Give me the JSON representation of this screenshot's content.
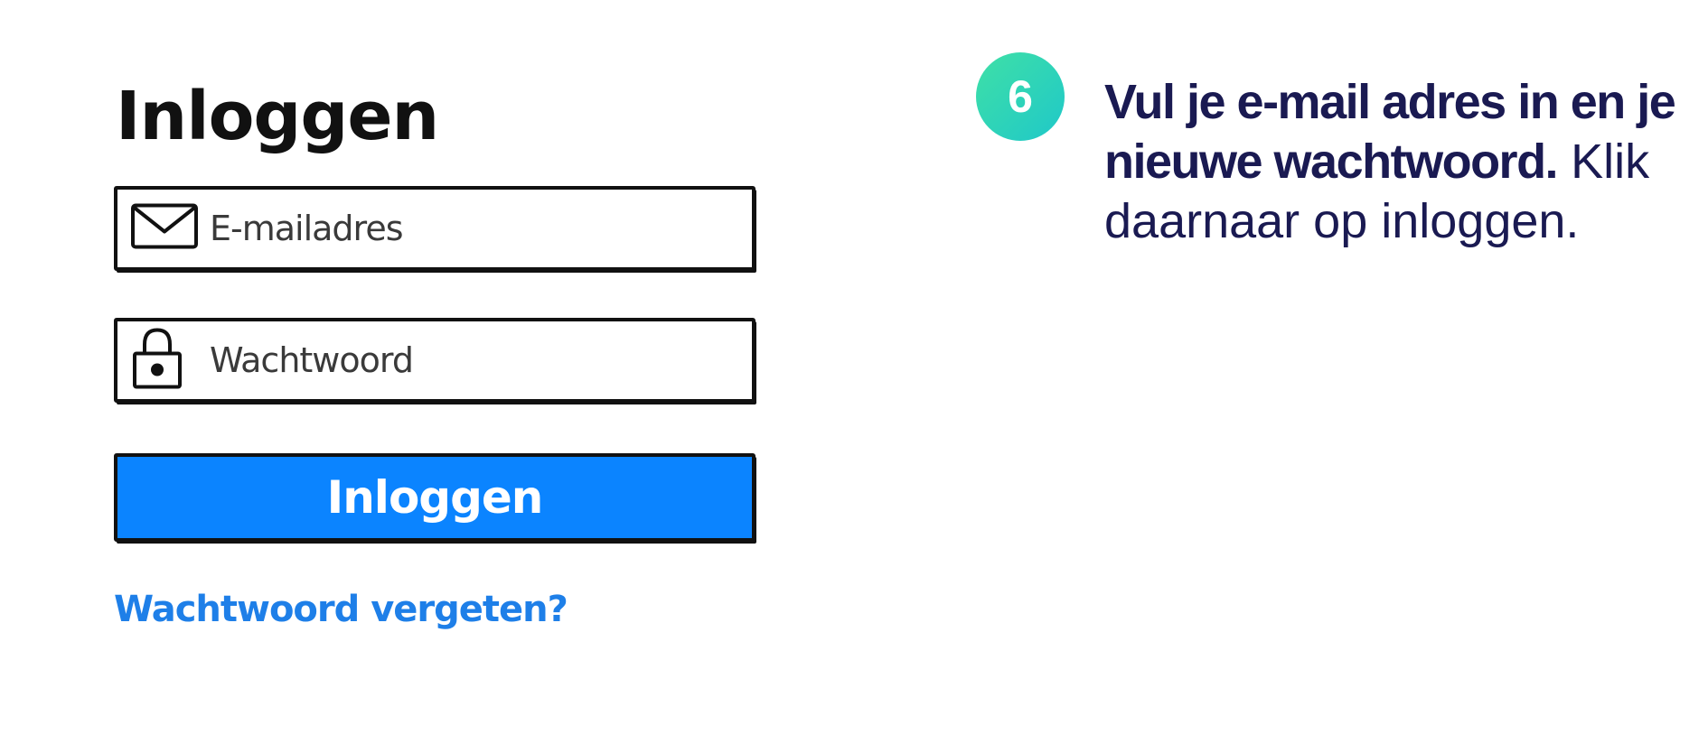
{
  "login_form": {
    "title": "Inloggen",
    "email_placeholder": "E-mailadres",
    "password_placeholder": "Wachtwoord",
    "submit_label": "Inloggen",
    "forgot_link": "Wachtwoord vergeten?",
    "icons": {
      "email": "mail-envelope-icon",
      "password": "padlock-icon"
    },
    "colors": {
      "button": "#0b84ff",
      "link": "#1e7fe8"
    }
  },
  "instruction": {
    "step_number": "6",
    "bold_line_1": "Vul je e-mail adres in en je",
    "bold_line_2": "nieuwe wachtwoord.",
    "normal_line_2": "Klik",
    "normal_line_3": "daarnaar op inloggen.",
    "colors": {
      "badge_start": "#3fe0a6",
      "badge_end": "#1fc8c9",
      "text": "#1a1a52"
    }
  }
}
